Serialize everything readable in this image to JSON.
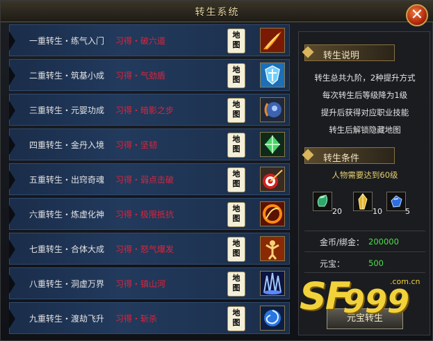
{
  "window": {
    "title": "转生系统"
  },
  "rows": [
    {
      "name": "一重转生・练气入门",
      "skill": "习得・破六道",
      "map": "地图"
    },
    {
      "name": "二重转生・筑基小成",
      "skill": "习得・气劲盾",
      "map": "地图"
    },
    {
      "name": "三重转生・元婴功成",
      "skill": "习得・暗影之步",
      "map": "地图"
    },
    {
      "name": "四重转生・金丹入境",
      "skill": "习得・坚韧",
      "map": "地图"
    },
    {
      "name": "五重转生・出窍奇魂",
      "skill": "习得・弱点击破",
      "map": "地图"
    },
    {
      "name": "六重转生・炼虚化神",
      "skill": "习得・极限抵抗",
      "map": "地图"
    },
    {
      "name": "七重转生・合体大成",
      "skill": "习得・怒气爆发",
      "map": "地图"
    },
    {
      "name": "八重转生・洞虚万界",
      "skill": "习得・镇山河",
      "map": "地图"
    },
    {
      "name": "九重转生・渡劫飞升",
      "skill": "习得・斩杀",
      "map": "地图"
    }
  ],
  "row_icons": [
    "flame-slash-icon",
    "shield-burst-icon",
    "shadow-step-icon",
    "green-crystal-icon",
    "bullseye-arrow-icon",
    "fire-ring-icon",
    "rage-figure-icon",
    "blue-spikes-icon",
    "blue-vortex-icon"
  ],
  "info": {
    "header": "转生说明",
    "lines": [
      "转生总共九阶，2种提升方式",
      "每次转生后等级降为1级",
      "提升后获得对应职业技能",
      "转生后解锁隐藏地图"
    ]
  },
  "conditions": {
    "header": "转生条件",
    "requirement": "人物需要达到60级",
    "items": [
      {
        "icon": "green-gem-icon",
        "count": "20"
      },
      {
        "icon": "gold-crystal-icon",
        "count": "10"
      },
      {
        "icon": "blue-gem-icon",
        "count": "5"
      }
    ]
  },
  "currency": [
    {
      "label": "金币/绑金：",
      "value": "200000"
    },
    {
      "label": "元宝：",
      "value": "500"
    }
  ],
  "button": {
    "label": "元宝转生"
  },
  "watermark": {
    "brand": "SF",
    "number": "999",
    "domain": ".com.cn"
  },
  "colors": {
    "skill_text": "#e0243b",
    "value_green": "#4de04a",
    "requirement_gold": "#e7cf6b"
  }
}
